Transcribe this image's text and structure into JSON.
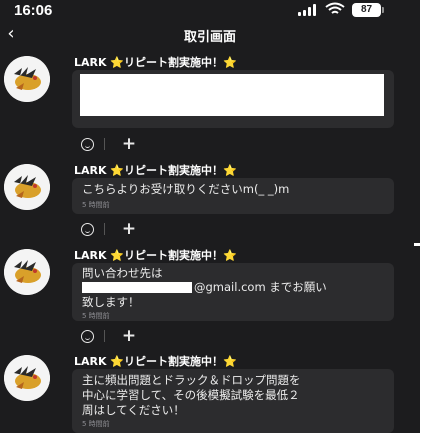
{
  "status_bar": {
    "time": "16:06",
    "battery": "87"
  },
  "header": {
    "back_icon": "chevron-left",
    "title": "取引画面"
  },
  "messages": [
    {
      "sender": "LARK ⭐リピート割実施中！⭐",
      "lines": [],
      "time": "",
      "redacted": true
    },
    {
      "sender": "LARK ⭐リピート割実施中！⭐",
      "lines": [
        "こちらよりお受け取りくださいm(_ _)m"
      ],
      "time": "5 時間前"
    },
    {
      "sender": "LARK ⭐リピート割実施中！⭐",
      "lines": [
        "問い合わせ先は",
        "@gmail.com までお願い",
        "致します！"
      ],
      "time": "5 時間前"
    },
    {
      "sender": "LARK ⭐リピート割実施中！⭐",
      "lines": [
        "主に頻出問題とドラック＆ドロップ問題を",
        "中心に学習して、その後模擬試験を最低２",
        "周はしてください！"
      ],
      "time": "5 時間前"
    }
  ],
  "reactions": {
    "add_icon": "plus",
    "emoji_icon": "smiley-face"
  },
  "colors": {
    "background": "#1c1c1e",
    "bubble": "#2c2c2e",
    "text": "#ececec",
    "muted": "#8e8e93"
  }
}
